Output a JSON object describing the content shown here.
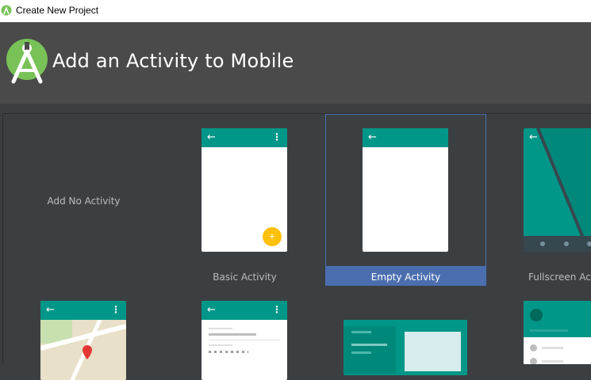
{
  "window": {
    "title": "Create New Project"
  },
  "header": {
    "title": "Add an Activity to Mobile"
  },
  "icons": {
    "back": "←",
    "overflow": "⋮",
    "fab": "+"
  },
  "colors": {
    "teal": "#009688",
    "amber": "#ffc107",
    "selection": "#4b6eaf",
    "header_bg": "#4a4a4a",
    "gallery_bg": "#3c3f41"
  },
  "templates": [
    {
      "label": "Add No Activity",
      "selected": false
    },
    {
      "label": "Basic Activity",
      "selected": false
    },
    {
      "label": "Empty Activity",
      "selected": true
    },
    {
      "label": "Fullscreen Activity",
      "selected": false
    }
  ]
}
